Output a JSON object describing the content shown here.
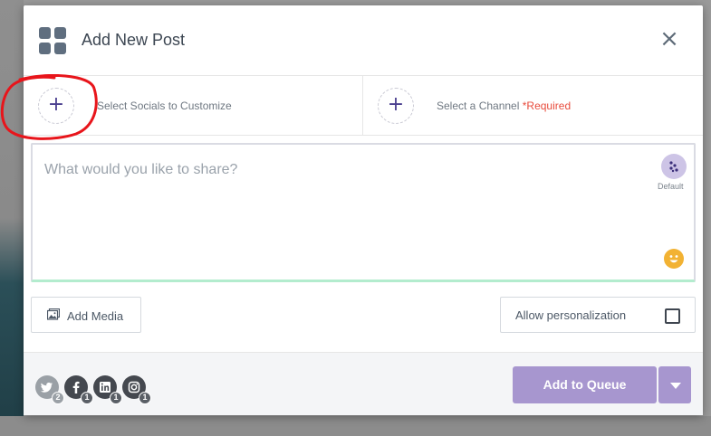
{
  "header": {
    "title": "Add New Post",
    "close_label": "×"
  },
  "selectors": {
    "socials": {
      "plus": "+",
      "label": "Select Socials to Customize"
    },
    "channel": {
      "plus": "+",
      "label": "Select a Channel",
      "required": "*Required"
    }
  },
  "composer": {
    "placeholder": "What would you like to share?",
    "default_label": "Default",
    "focus_border_color": "#b3ecce"
  },
  "actions": {
    "add_media_label": "Add Media",
    "allow_personalization_label": "Allow personalization",
    "allow_personalization_checked": false
  },
  "footer": {
    "socials": [
      {
        "network": "twitter",
        "icon": "twitter-icon",
        "count": "2"
      },
      {
        "network": "facebook",
        "icon": "facebook-icon",
        "count": "1"
      },
      {
        "network": "linkedin",
        "icon": "linkedin-icon",
        "count": "1"
      },
      {
        "network": "instagram",
        "icon": "instagram-icon",
        "count": "1"
      }
    ],
    "add_to_queue_label": "Add to Queue"
  },
  "colors": {
    "accent": "#a796cf",
    "required": "#e84c3d",
    "annotation": "#e8151b"
  }
}
